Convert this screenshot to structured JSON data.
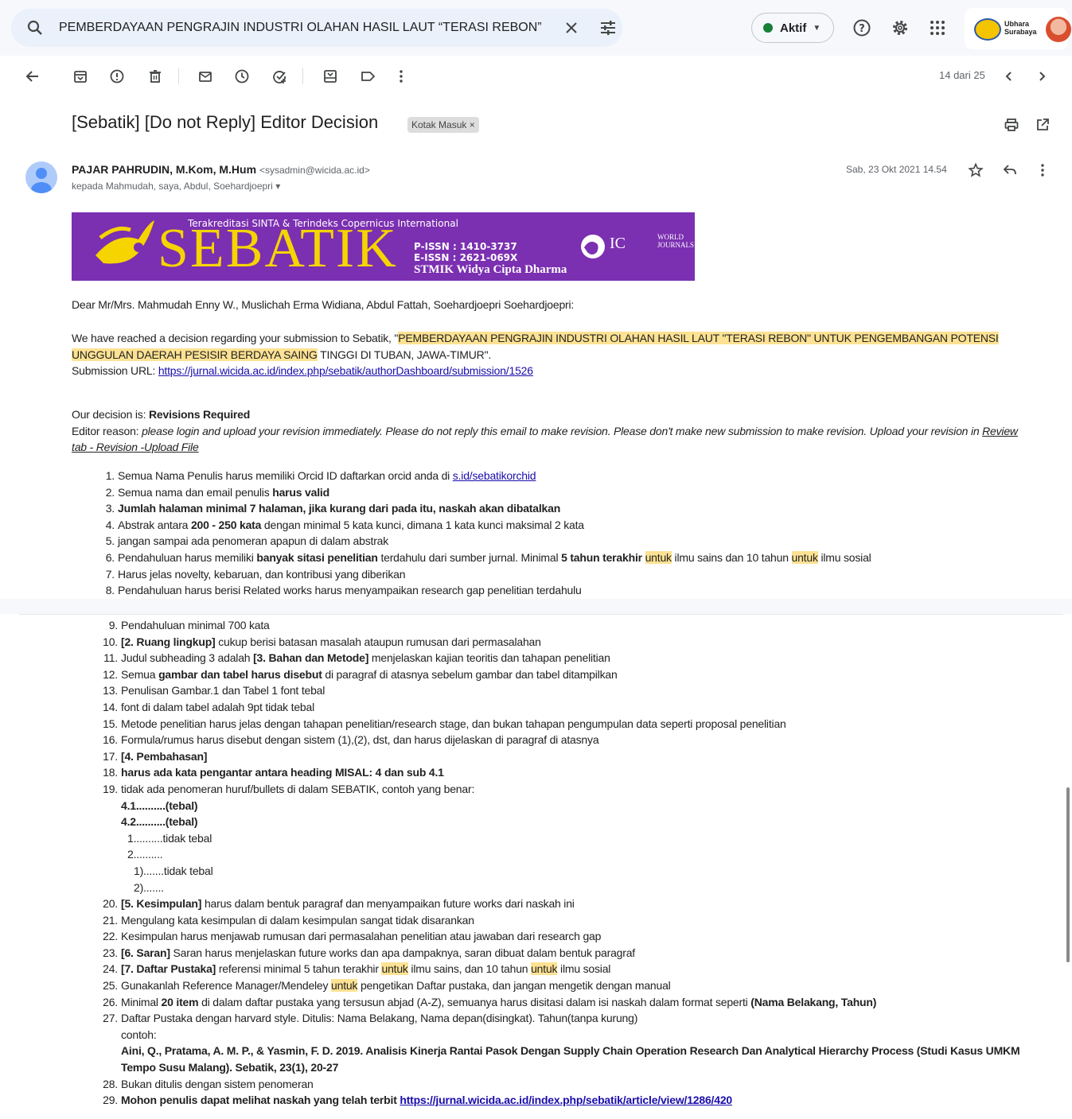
{
  "search": {
    "query": "PEMBERDAYAAN PENGRAJIN INDUSTRI OLAHAN HASIL LAUT “TERASI REBON”"
  },
  "status": {
    "label": "Aktif"
  },
  "account": {
    "org_line1": "Ubhara",
    "org_line2": "Surabaya"
  },
  "toolbar": {
    "counter": "14 dari 25"
  },
  "email": {
    "subject": "[Sebatik] [Do not Reply] Editor Decision",
    "label": "Kotak Masuk ×",
    "sender_name": "PAJAR PAHRUDIN, M.Kom, M.Hum",
    "sender_email": "<sysadmin@wicida.ac.id>",
    "recipients": "kepada Mahmudah, saya, Abdul, Soehardjoepri",
    "date": "Sab, 23 Okt 2021 14.54"
  },
  "banner": {
    "tagline": "Terakreditasi SINTA & Terindeks Copernicus International",
    "word": "SEBATIK",
    "pissn": "P-ISSN : 1410-3737",
    "eissn": "E-ISSN : 2621-069X",
    "institution": "STMIK Widya Cipta Dharma",
    "ici": "IC",
    "wj1": "WORLD",
    "wj2": "JOURNALS"
  },
  "body": {
    "greeting": "Dear Mr/Mrs. Mahmudah Enny W., Muslichah Erma Widiana, Abdul Fattah, Soehardjoepri Soehardjoepri:",
    "intro_pre": "We have reached a decision regarding your submission to Sebatik, \"",
    "title_hl": "PEMBERDAYAAN PENGRAJIN INDUSTRI OLAHAN HASIL LAUT \"TERASI REBON\" UNTUK PENGEMBANGAN POTENSI UNGGULAN DAERAH PESISIR BERDAYA SAING",
    "intro_post": " TINGGI DI TUBAN, JAWA-TIMUR\".",
    "submission_label": "Submission URL: ",
    "submission_url": "https://jurnal.wicida.ac.id/index.php/sebatik/authorDashboard/submission/1526",
    "decision_label": "Our decision is: ",
    "decision": "Revisions Required",
    "reason_label": "Editor reason: ",
    "reason": "please login and upload your revision immediately. Please do not reply this email to make revision. Please don't make new submission to make revision. Upload your revision in ",
    "reason_link1": "Review",
    "reason_link2": "tab - Revision -Upload File"
  },
  "items": {
    "i1a": "Semua Nama Penulis harus memiliki Orcid ID daftarkan orcid anda di ",
    "i1link": "s.id/sebatikorchid",
    "i2a": "Semua nama dan email penulis ",
    "i2b": "harus valid",
    "i3": "Jumlah halaman minimal 7 halaman, jika kurang dari pada itu, naskah akan dibatalkan",
    "i4a": "Abstrak antara ",
    "i4b": "200 - 250 kata",
    "i4c": " dengan minimal 5 kata kunci, dimana 1 kata kunci maksimal 2 kata",
    "i5": "jangan sampai ada penomeran apapun di dalam abstrak",
    "i6a": "Pendahuluan harus memiliki ",
    "i6b": "banyak sitasi penelitian",
    "i6c": " terdahulu dari sumber jurnal. Minimal ",
    "i6d": "5 tahun terakhir",
    "i6e": "untuk",
    "i6f": " ilmu sains dan 10 tahun ",
    "i6g": " ilmu sosial",
    "i7": "Harus jelas novelty, kebaruan, dan kontribusi yang diberikan",
    "i8": "Pendahuluan harus berisi Related works harus menyampaikan research gap penelitian terdahulu",
    "i9": "Pendahuluan minimal 700 kata",
    "i10a": "[2. Ruang lingkup]",
    "i10b": " cukup berisi batasan masalah ataupun rumusan dari permasalahan",
    "i11a": "Judul subheading 3 adalah ",
    "i11b": "[3. Bahan dan Metode]",
    "i11c": " menjelaskan kajian teoritis dan tahapan penelitian",
    "i12a": "Semua ",
    "i12b": "gambar dan tabel harus disebut",
    "i12c": " di paragraf di atasnya sebelum gambar dan tabel ditampilkan",
    "i13": "Penulisan Gambar.1 dan Tabel 1 font tebal",
    "i14": "font di dalam tabel adalah 9pt tidak tebal",
    "i15": "Metode penelitian harus jelas dengan tahapan penelitian/research stage, dan bukan tahapan pengumpulan data seperti proposal penelitian",
    "i16": " Formula/rumus harus disebut dengan sistem (1),(2), dst, dan harus dijelaskan di paragraf di atasnya",
    "i17": "[4. Pembahasan]",
    "i18": "harus ada kata pengantar antara heading MISAL: 4 dan sub 4.1",
    "i19": "tidak ada penomeran huruf/bullets di dalam SEBATIK, contoh yang benar:",
    "s1": "4.1..........(tebal)",
    "s2": "4.2..........(tebal)",
    "s3": "1..........tidak tebal",
    "s4": "2..........",
    "s5": "1).......tidak tebal",
    "s6": "2).......",
    "i20a": "[5. Kesimpulan]",
    "i20b": " harus dalam bentuk paragraf dan menyampaikan future works dari naskah ini",
    "i21": "Mengulang kata kesimpulan di dalam kesimpulan sangat tidak disarankan",
    "i22": "Kesimpulan harus menjawab rumusan dari permasalahan penelitian atau jawaban dari research gap",
    "i23a": "[6. Saran]",
    "i23b": " Saran harus menjelaskan future works dan apa dampaknya, saran dibuat dalam bentuk paragraf",
    "i24a": "[7. Daftar Pustaka]",
    "i24b": " referensi minimal 5 tahun terakhir ",
    "i24c": " ilmu sains, dan 10 tahun ",
    "i24d": " ilmu sosial",
    "i25a": "Gunakanlah Reference Manager/Mendeley ",
    "i25b": " pengetikan Daftar pustaka, dan jangan mengetik dengan manual",
    "i26a": "Minimal ",
    "i26b": "20 item",
    "i26c": " di dalam daftar pustaka yang tersusun abjad (A-Z), semuanya harus disitasi dalam isi naskah dalam format seperti ",
    "i26d": "(Nama Belakang, Tahun)",
    "i27": "Daftar Pustaka dengan harvard style. Ditulis: Nama Belakang, Nama depan(disingkat). Tahun(tanpa kurung)",
    "i27ex": "contoh:",
    "i27ref1": "Aini, Q., Pratama, A. M. P., & Yasmin, F. D. 2019. Analisis Kinerja Rantai Pasok Dengan Supply Chain Operation Research Dan Analytical Hierarchy    Process (Studi Kasus UMKM",
    "i27ref2": "Tempo Susu Malang). Sebatik, 23(1), 20-27",
    "i28": "Bukan ditulis dengan sistem penomeran",
    "i29a": "Mohon penulis dapat melihat naskah yang telah terbit ",
    "i29link": "https://jurnal.wicida.ac.id/index.php/sebatik/article/view/1286/420"
  },
  "numbers": [
    "1.",
    "2.",
    "3.",
    "4.",
    "5.",
    "6.",
    "7.",
    "8.",
    "9.",
    "10.",
    "11.",
    "12.",
    "13.",
    "14.",
    "15.",
    "16.",
    "17.",
    "18.",
    "19.",
    "20.",
    "21.",
    "22.",
    "23.",
    "24.",
    "25.",
    "26.",
    "27.",
    "28.",
    "29."
  ]
}
